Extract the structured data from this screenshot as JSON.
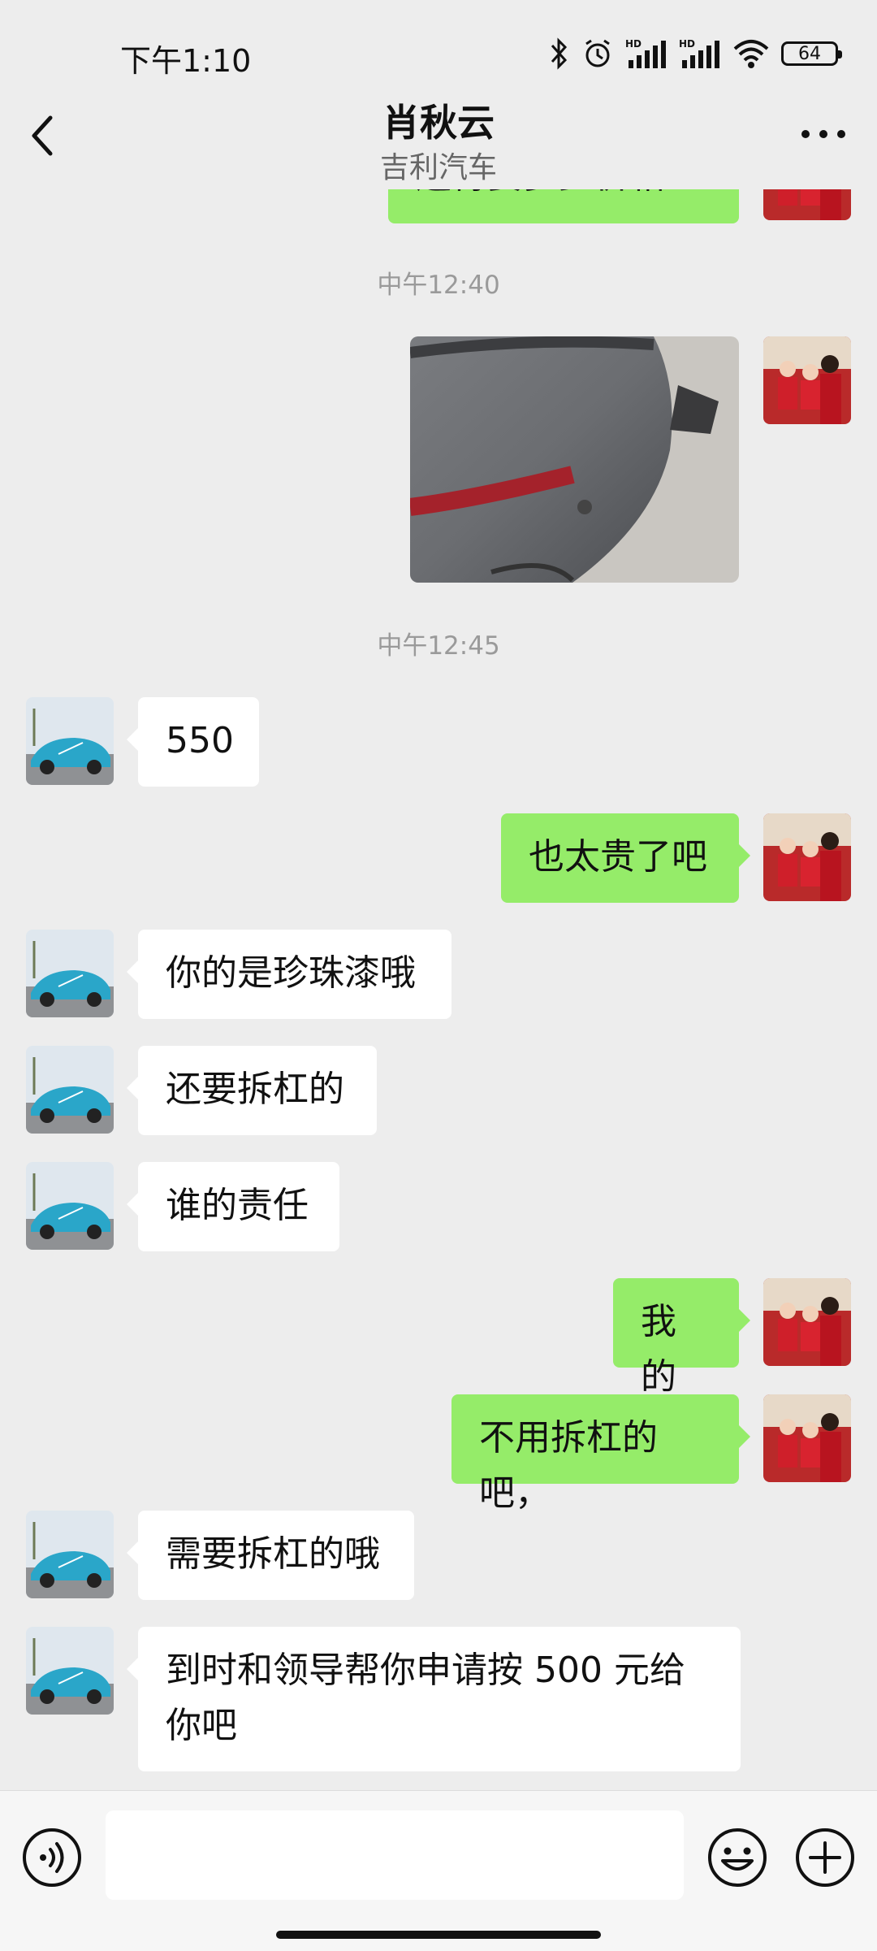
{
  "status_bar": {
    "time": "下午1:10",
    "battery": "64"
  },
  "header": {
    "title": "肖秋云",
    "subtitle": "吉利汽车"
  },
  "messages": [
    {
      "sender": "me",
      "type": "text",
      "text": "还得要多少价格"
    },
    {
      "type": "timestamp",
      "text": "中午12:40"
    },
    {
      "sender": "me",
      "type": "image",
      "text": ""
    },
    {
      "type": "timestamp",
      "text": "中午12:45"
    },
    {
      "sender": "them",
      "type": "text",
      "text": "550"
    },
    {
      "sender": "me",
      "type": "text",
      "text": "也太贵了吧"
    },
    {
      "sender": "them",
      "type": "text",
      "text": "你的是珍珠漆哦"
    },
    {
      "sender": "them",
      "type": "text",
      "text": "还要拆杠的"
    },
    {
      "sender": "them",
      "type": "text",
      "text": "谁的责任"
    },
    {
      "sender": "me",
      "type": "text",
      "text": "我的"
    },
    {
      "sender": "me",
      "type": "text",
      "text": "不用拆杠的吧，"
    },
    {
      "sender": "them",
      "type": "text",
      "text": "需要拆杠的哦"
    },
    {
      "sender": "them",
      "type": "text",
      "text": "到时和领导帮你申请按 500 元给你吧"
    }
  ],
  "input_bar": {
    "value": ""
  },
  "icons": {
    "back": "chevron-left-icon",
    "more": "more-dots-icon",
    "voice": "voice-icon",
    "emoji": "emoji-icon",
    "plus": "plus-icon"
  },
  "colors": {
    "background": "#ededed",
    "my_bubble": "#95ec69",
    "their_bubble": "#ffffff"
  }
}
